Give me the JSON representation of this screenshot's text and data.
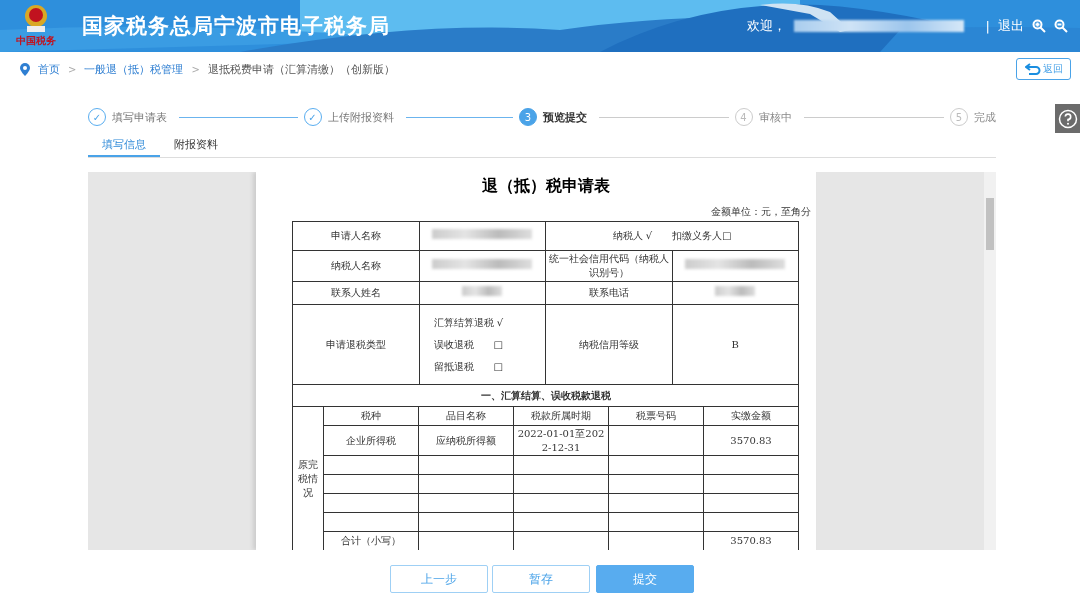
{
  "header": {
    "title": "国家税务总局宁波市电子税务局",
    "logo_caption": "中国税务",
    "welcome": "欢迎，",
    "separator": "|",
    "logout": "退出"
  },
  "breadcrumb": {
    "separator": ">",
    "items": [
      {
        "label": "首页",
        "link": true
      },
      {
        "label": "一般退（抵）税管理",
        "link": true
      },
      {
        "label": "退抵税费申请（汇算清缴）（创新版）",
        "link": false
      }
    ]
  },
  "back_button": "返回",
  "steps": [
    {
      "marker": "✓",
      "label": "填写申请表",
      "done": true,
      "selected": false
    },
    {
      "marker": "✓",
      "label": "上传附报资料",
      "done": true,
      "selected": false
    },
    {
      "marker": "3",
      "label": "预览提交",
      "done": false,
      "selected": true
    },
    {
      "marker": "4",
      "label": "审核中",
      "done": false,
      "selected": false
    },
    {
      "marker": "5",
      "label": "完成",
      "done": false,
      "selected": false
    }
  ],
  "tabs": [
    {
      "label": "填写信息",
      "selected": true
    },
    {
      "label": "附报资料",
      "selected": false
    }
  ],
  "document": {
    "title": "退（抵）税申请表",
    "unit": "金额单位：元，至角分",
    "info_rows": [
      {
        "cells": [
          {
            "text": "申请人名称"
          },
          {
            "redacted": true
          },
          {
            "text": "纳税人 √　　扣缴义务人□"
          }
        ]
      },
      {
        "cells": [
          {
            "text": "纳税人名称"
          },
          {
            "redacted": true
          },
          {
            "text": "统一社会信用代码（纳税人识别号）"
          },
          {
            "redacted": true
          }
        ]
      },
      {
        "cells": [
          {
            "text": "联系人姓名"
          },
          {
            "redacted": true
          },
          {
            "text": "联系电话"
          },
          {
            "redacted": true
          }
        ]
      },
      {
        "cells": [
          {
            "text": "申请退税类型"
          },
          {
            "lines": [
              "汇算结算退税 √",
              "误收退税　　□",
              "留抵退税　　□"
            ]
          },
          {
            "text": "纳税信用等级"
          },
          {
            "text": "B"
          }
        ]
      }
    ],
    "section": "一、汇算结算、误收税款退税",
    "side_label": "原完税情况",
    "columns": [
      "税种",
      "品目名称",
      "税款所属时期",
      "税票号码",
      "实缴金额"
    ],
    "rows": [
      {
        "tax_type": "企业所得税",
        "item": "应纳税所得额",
        "period": "2022-01-01至2022-12-31",
        "amount": "3570.83"
      }
    ],
    "total_row": {
      "label": "合计（小写）",
      "amount": "3570.83"
    }
  },
  "buttons": [
    {
      "label": "上一步",
      "kind": "secondary"
    },
    {
      "label": "暂存",
      "kind": "secondary"
    },
    {
      "label": "提交",
      "kind": "primary"
    }
  ]
}
